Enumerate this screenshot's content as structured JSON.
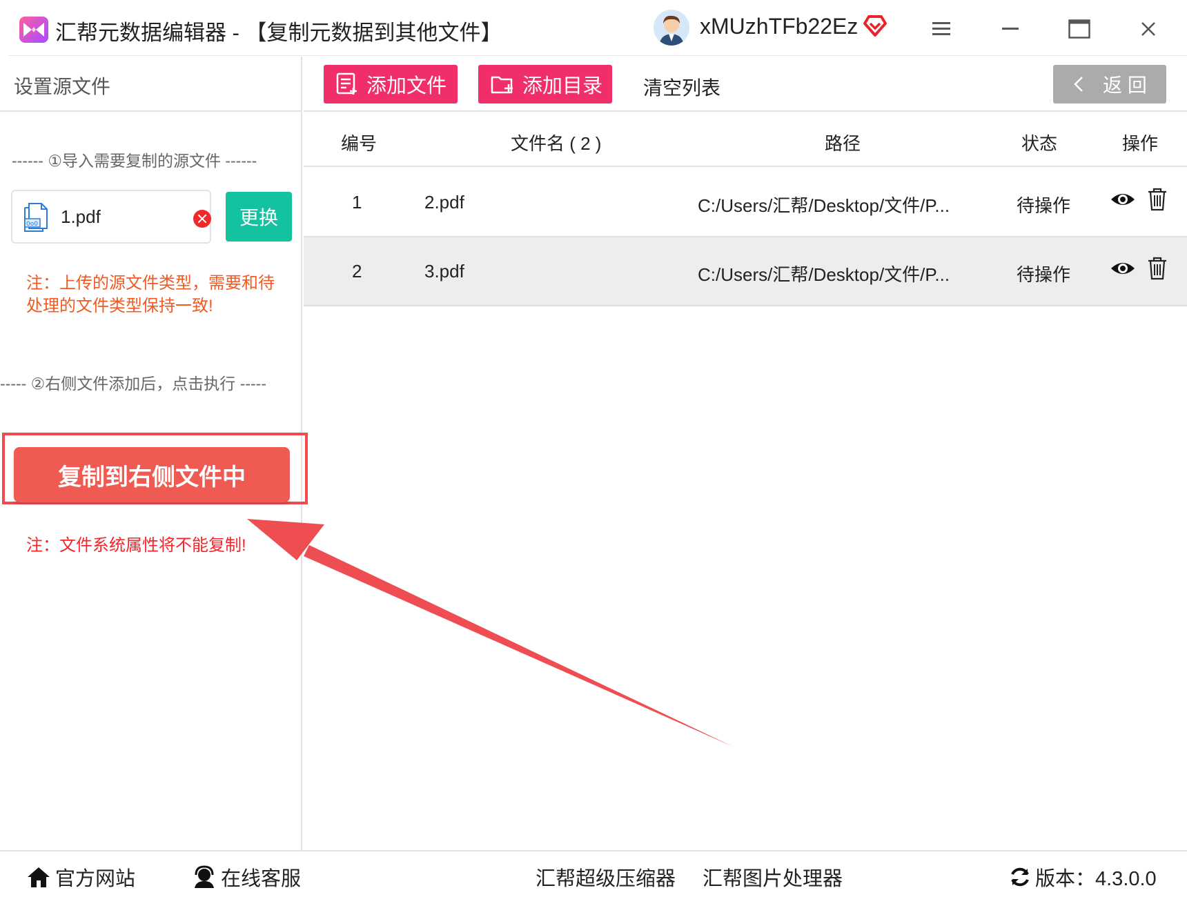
{
  "window": {
    "app_title": "汇帮元数据编辑器 - 【复制元数据到其他文件】",
    "username": "xMUzhTFb22Ez",
    "brand_color": "#ef2e6a"
  },
  "left_panel": {
    "header": "设置源文件",
    "step1": "------ ①导入需要复制的源文件 ------",
    "source_file": "1.pdf",
    "replace_label": "更换",
    "note1": "注：上传的源文件类型，需要和待处理的文件类型保持一致!",
    "step2": "----- ②右侧文件添加后，点击执行 -----",
    "execute_label": "复制到右侧文件中",
    "note2": "注：文件系统属性将不能复制!"
  },
  "toolbar": {
    "add_file": "添加文件",
    "add_dir": "添加目录",
    "clear_list": "清空列表",
    "back": "返 回"
  },
  "table": {
    "headers": {
      "index": "编号",
      "filename": "文件名 ( 2 )",
      "path": "路径",
      "status": "状态",
      "action": "操作"
    },
    "rows": [
      {
        "index": "1",
        "filename": "2.pdf",
        "path": "C:/Users/汇帮/Desktop/文件/P...",
        "status": "待操作"
      },
      {
        "index": "2",
        "filename": "3.pdf",
        "path": "C:/Users/汇帮/Desktop/文件/P...",
        "status": "待操作"
      }
    ]
  },
  "footer": {
    "website": "官方网站",
    "support": "在线客服",
    "compressor": "汇帮超级压缩器",
    "image_tool": "汇帮图片处理器",
    "version": "版本：4.3.0.0"
  }
}
